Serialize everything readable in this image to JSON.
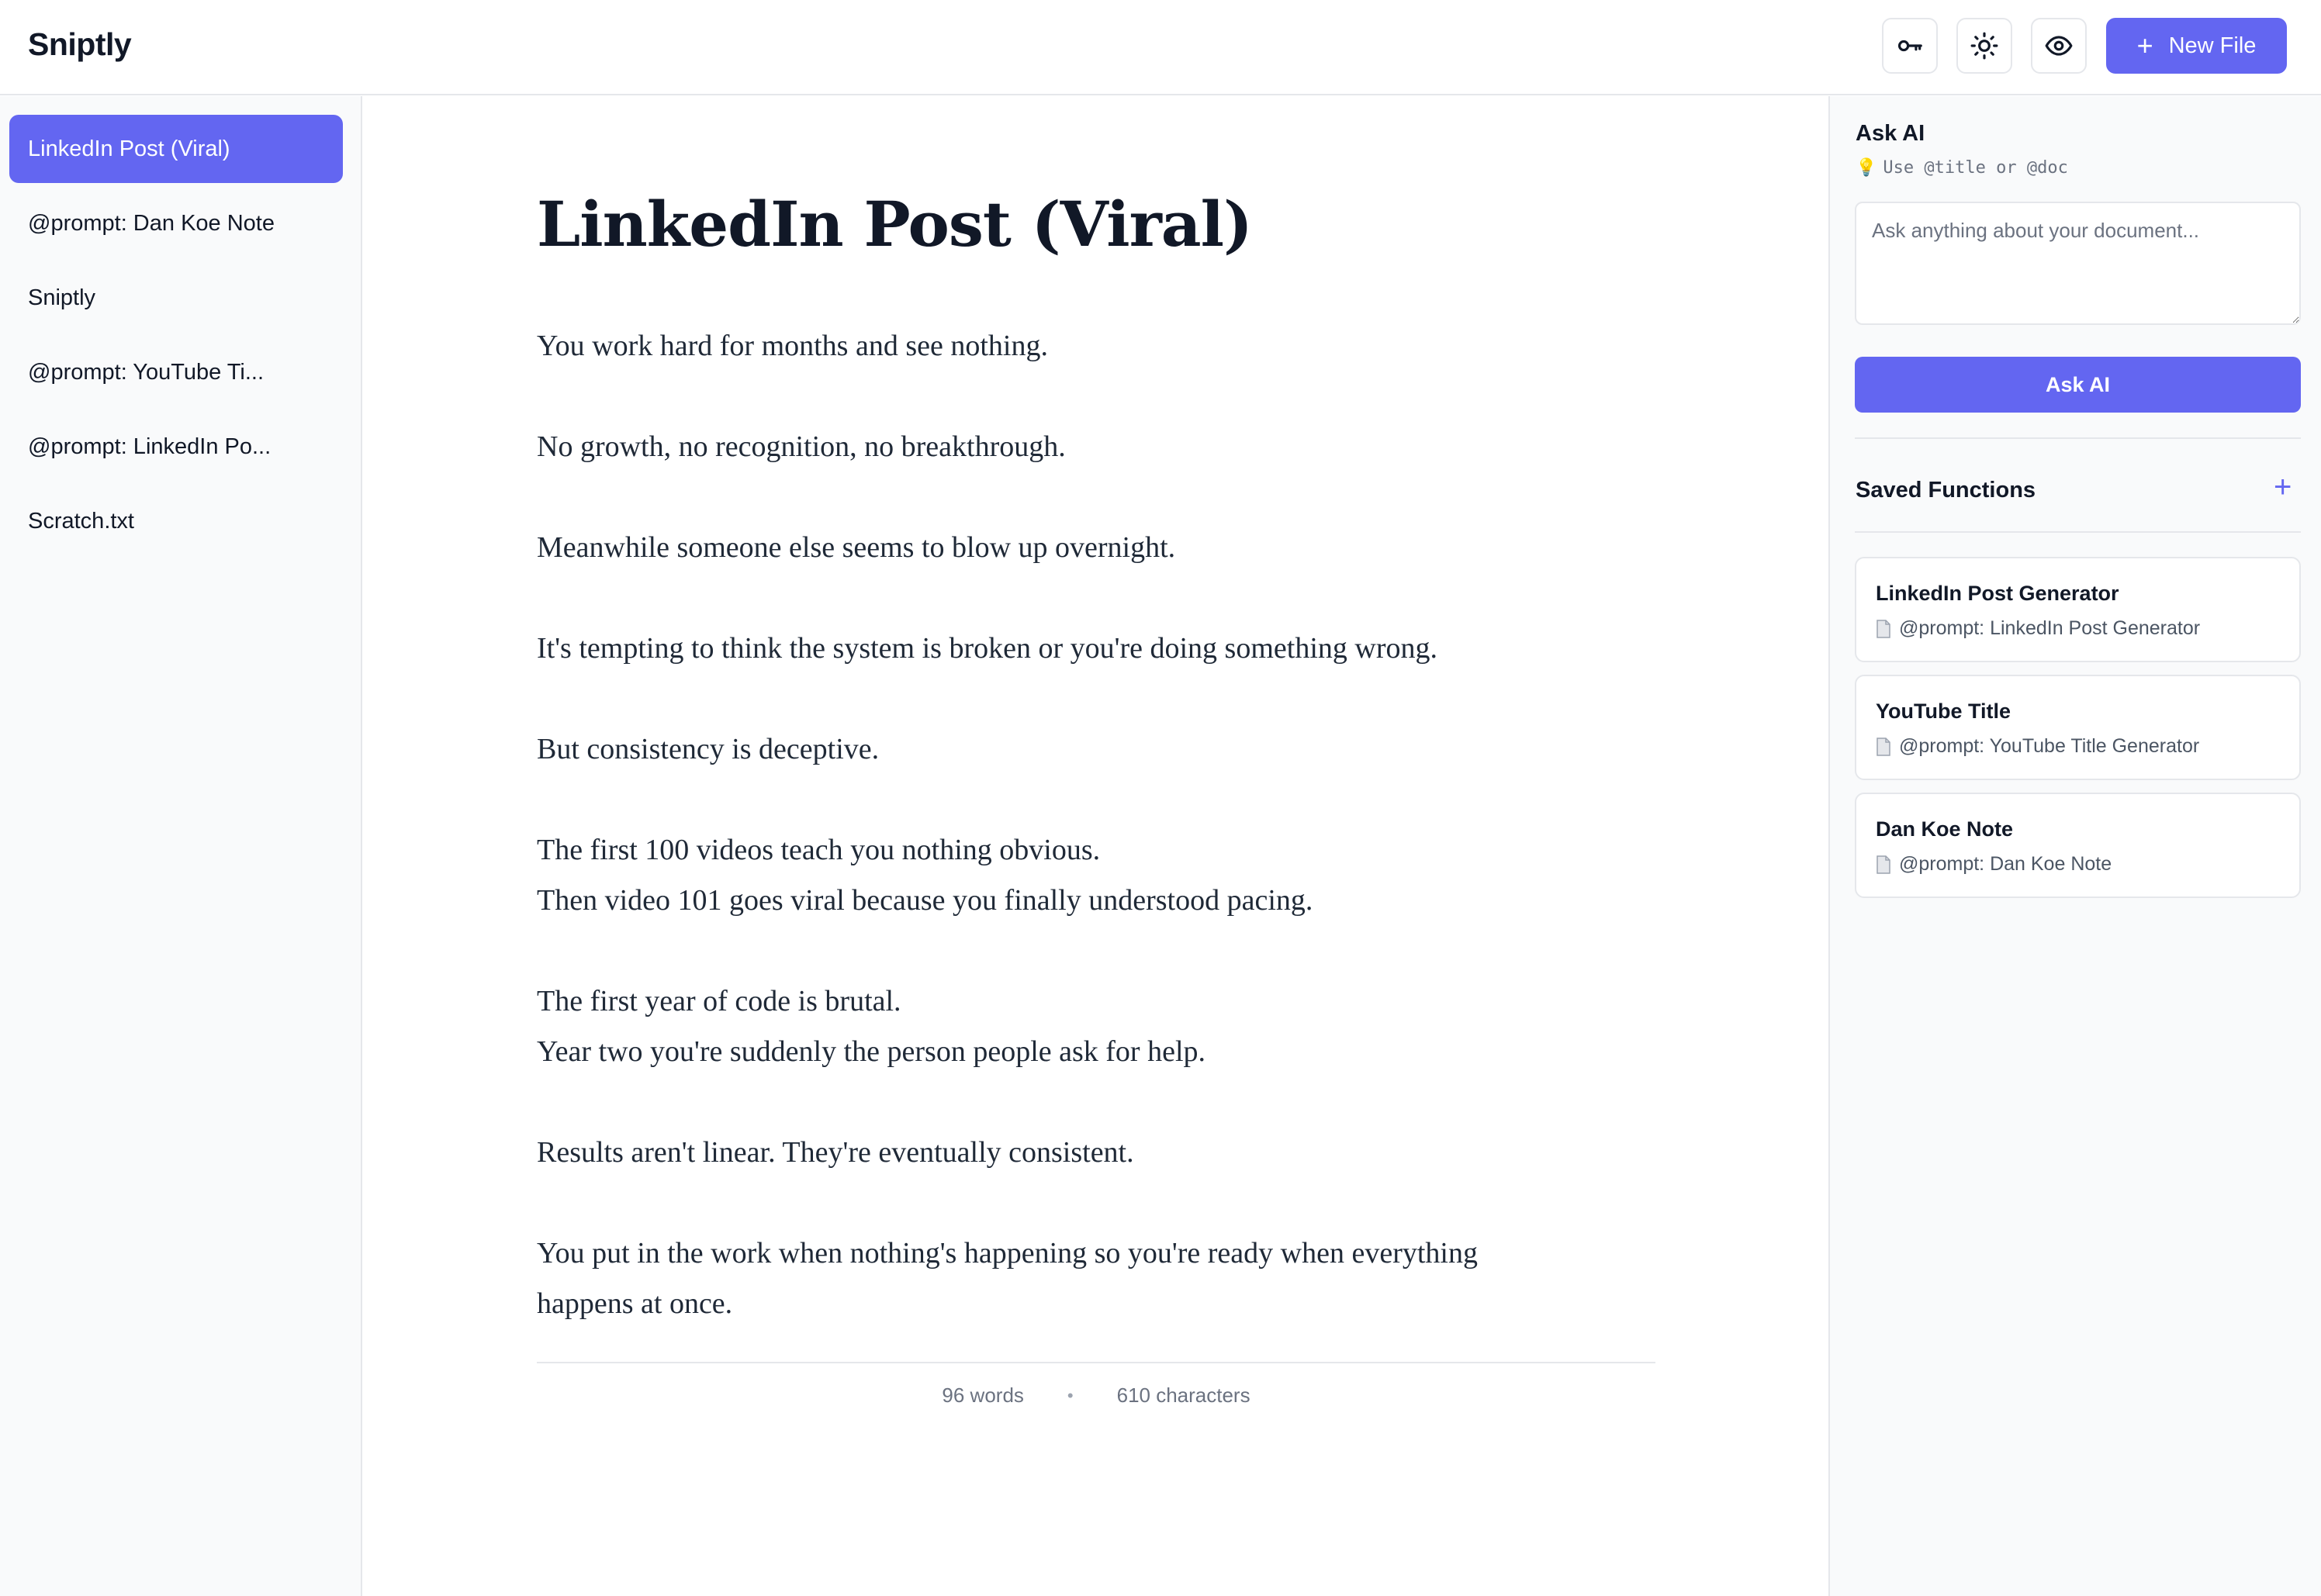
{
  "app": {
    "name": "Sniptly",
    "new_file_label": "New File",
    "icons": [
      "key-icon",
      "sun-icon",
      "eye-icon",
      "plus-icon"
    ]
  },
  "sidebar": {
    "items": [
      {
        "label": "LinkedIn Post (Viral)",
        "active": true
      },
      {
        "label": "@prompt: Dan Koe Note",
        "active": false
      },
      {
        "label": "Sniptly",
        "active": false
      },
      {
        "label": "@prompt: YouTube Ti...",
        "active": false
      },
      {
        "label": "@prompt: LinkedIn Po...",
        "active": false
      },
      {
        "label": "Scratch.txt",
        "active": false
      }
    ]
  },
  "document": {
    "title": "LinkedIn Post (Viral)",
    "lines": [
      "You work hard for months and see nothing.",
      "",
      "No growth, no recognition, no breakthrough.",
      "",
      "Meanwhile someone else seems to blow up overnight.",
      "",
      "It's tempting to think the system is broken or you're doing something wrong.",
      "",
      "But consistency is deceptive.",
      "",
      "The first 100 videos teach you nothing obvious.",
      "Then video 101 goes viral because you finally understood pacing.",
      "",
      "The first year of code is brutal.",
      "Year two you're suddenly the person people ask for help.",
      "",
      "Results aren't linear. They're eventually consistent.",
      "",
      "You put in the work when nothing's happening so you're ready when everything",
      "happens at once."
    ],
    "word_count": "96 words",
    "char_count": "610 characters",
    "stats_separator": "•"
  },
  "ask_ai": {
    "title": "Ask AI",
    "hint_icon": "💡",
    "hint": "Use @title or @doc",
    "placeholder": "Ask anything about your document...",
    "value": "",
    "button_label": "Ask AI"
  },
  "saved_functions": {
    "title": "Saved Functions",
    "add_label": "+",
    "items": [
      {
        "name": "LinkedIn Post Generator",
        "ref": "@prompt: LinkedIn Post Generator"
      },
      {
        "name": "YouTube Title",
        "ref": "@prompt: YouTube Title Generator"
      },
      {
        "name": "Dan Koe Note",
        "ref": "@prompt: Dan Koe Note"
      }
    ]
  },
  "colors": {
    "accent": "#6366f1",
    "panel_bg": "#f9fafb",
    "border": "#e5e7eb",
    "text": "#111827",
    "muted": "#6b7280"
  }
}
